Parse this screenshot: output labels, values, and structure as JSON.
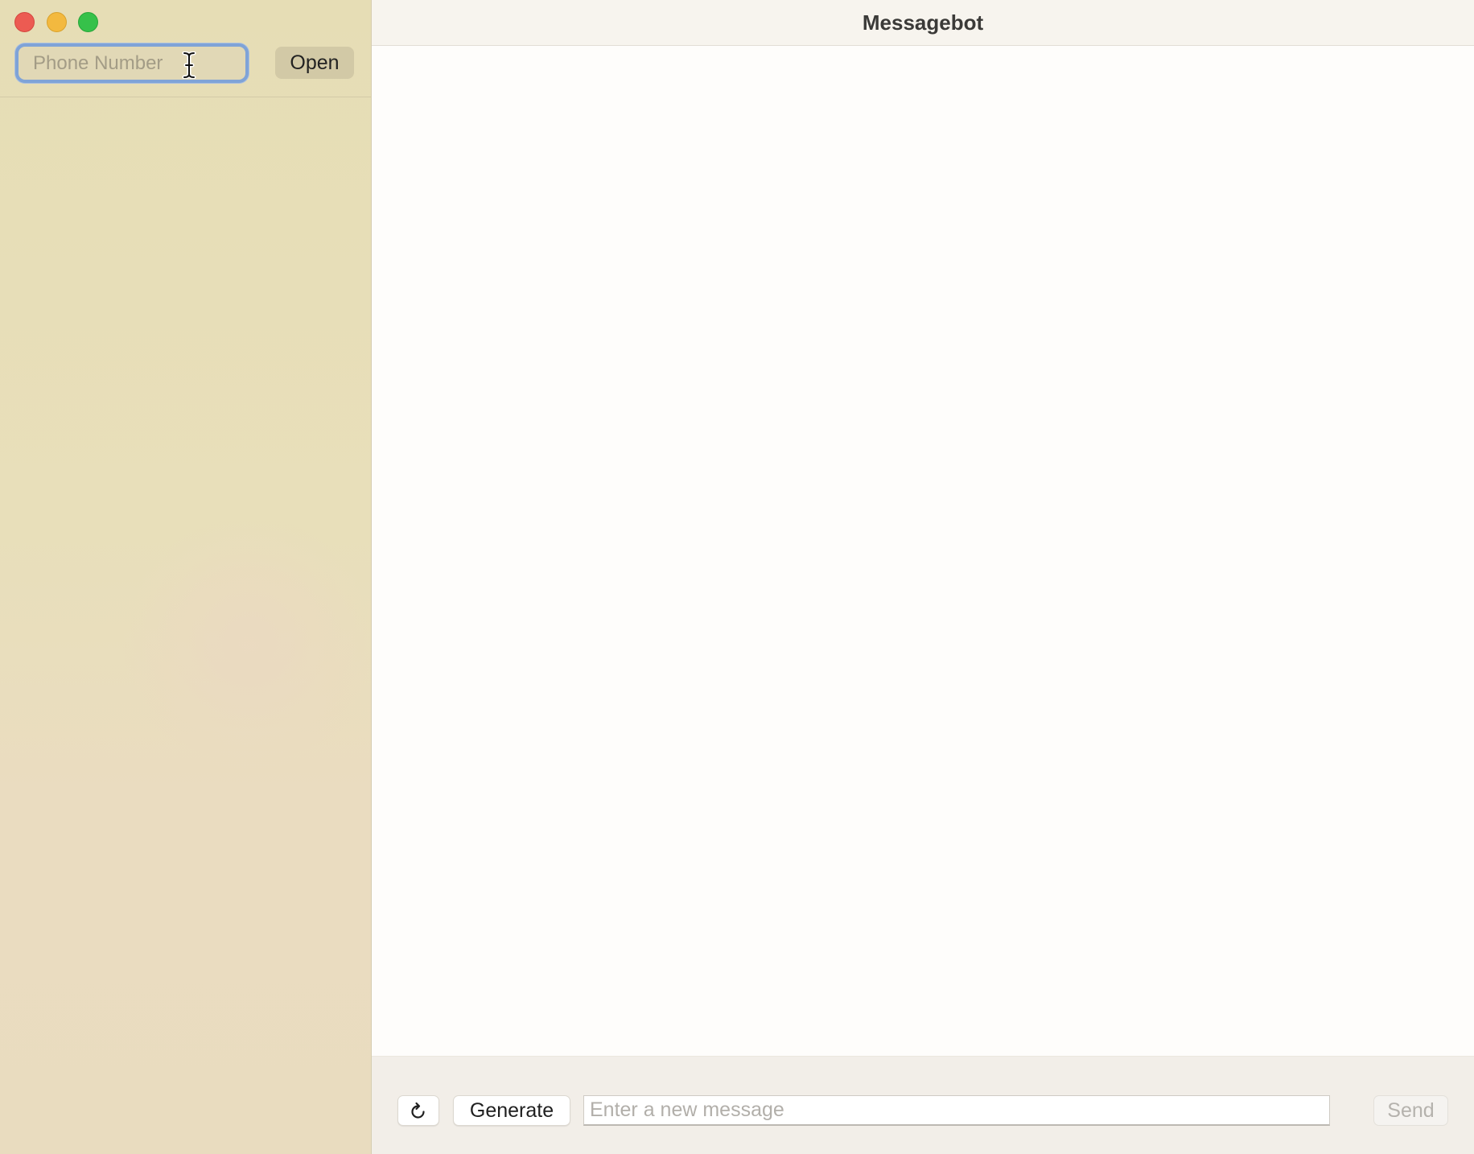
{
  "window": {
    "title": "Messagebot"
  },
  "sidebar": {
    "phone_input": {
      "value": "",
      "placeholder": "Phone Number"
    },
    "open_label": "Open"
  },
  "composer": {
    "refresh_icon": "refresh-icon",
    "generate_label": "Generate",
    "message_input": {
      "value": "",
      "placeholder": "Enter a new message"
    },
    "send_label": "Send"
  },
  "colors": {
    "sidebar_bg": "#e6ddb5",
    "focus_ring": "#7fa3d7",
    "close": "#ec5b52",
    "minimize": "#f3b93f",
    "maximize": "#36c14a"
  }
}
